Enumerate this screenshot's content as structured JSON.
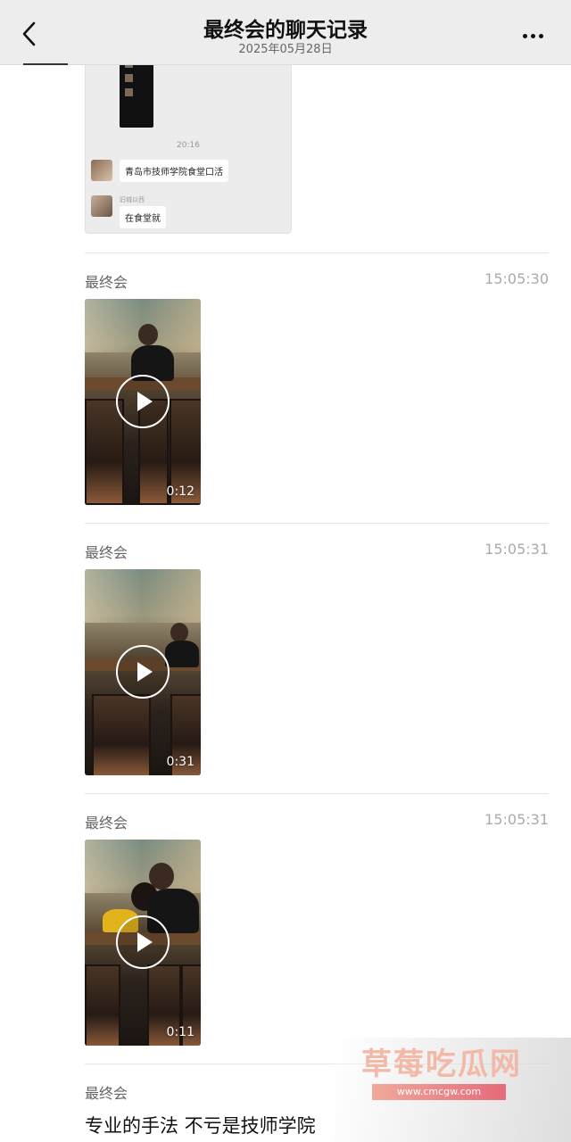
{
  "header": {
    "title": "最终会的聊天记录",
    "subtitle": "2025年05月28日"
  },
  "quote_card": {
    "time": "20:16",
    "messages": [
      {
        "name": "",
        "text": "青岛市技师学院食堂口活"
      },
      {
        "name": "旧城以西",
        "text": "在食堂就"
      }
    ]
  },
  "messages": [
    {
      "sender": "最终会",
      "time": "15:05:30",
      "type": "video",
      "duration": "0:12"
    },
    {
      "sender": "最终会",
      "time": "15:05:31",
      "type": "video",
      "duration": "0:31"
    },
    {
      "sender": "最终会",
      "time": "15:05:31",
      "type": "video",
      "duration": "0:11"
    },
    {
      "sender": "最终会",
      "time": "",
      "type": "text",
      "text": "专业的手法 不亏是技师学院"
    }
  ],
  "watermark": {
    "title": "草莓吃瓜网",
    "url": "www.cmcgw.com"
  }
}
